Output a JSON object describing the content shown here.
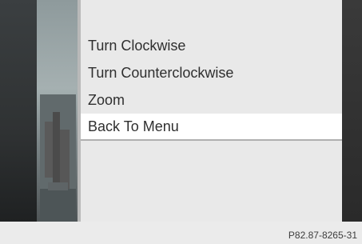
{
  "menu": {
    "items": [
      {
        "label": "Turn Clockwise",
        "selected": false
      },
      {
        "label": "Turn Counterclockwise",
        "selected": false
      },
      {
        "label": "Zoom",
        "selected": false
      },
      {
        "label": "Back To Menu",
        "selected": true
      }
    ]
  },
  "footer": {
    "reference": "P82.87-8265-31"
  },
  "colors": {
    "panel_bg": "#e9e9e9",
    "selected_bg": "#ffffff",
    "text": "#2f2f2f",
    "frame_dark": "#2b2b2b"
  }
}
